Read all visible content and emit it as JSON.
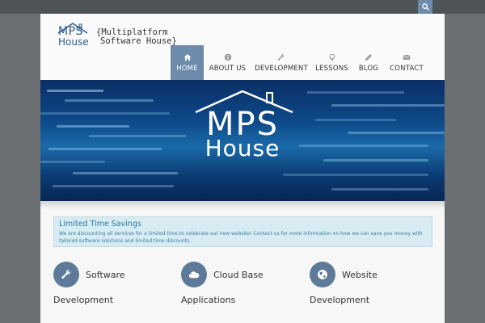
{
  "colors": {
    "accent": "#6d8bab",
    "topbar": "#4e5357",
    "outer": "#6b6f72",
    "notice_bg": "#d7ebf3",
    "notice_text": "#2e7a9c",
    "service_circle": "#5d7b99"
  },
  "topbar": {
    "search_icon": "search-icon"
  },
  "header": {
    "logo_line1": "MPS",
    "logo_line2": "House",
    "tagline_line1": "{Multiplatform",
    "tagline_line2": "Software House}"
  },
  "nav": {
    "items": [
      {
        "label": "HOME",
        "icon": "home-icon",
        "active": true
      },
      {
        "label": "ABOUT US",
        "icon": "info-icon",
        "active": false
      },
      {
        "label": "DEVELOPMENT",
        "icon": "wrench-icon",
        "active": false
      },
      {
        "label": "LESSONS",
        "icon": "lightbulb-icon",
        "active": false
      },
      {
        "label": "BLOG",
        "icon": "pencil-icon",
        "active": false
      },
      {
        "label": "CONTACT",
        "icon": "envelope-icon",
        "active": false
      }
    ]
  },
  "hero": {
    "title": "MPS",
    "subtitle": "House"
  },
  "notice": {
    "title": "Limited Time Savings",
    "text": "We are discounting all services for a limited time to celebrate out new website! Contact us for more information on how we can save you money with tailored software solutions and limited time discounts."
  },
  "services": [
    {
      "title_line1": "Software",
      "title_line2": "Development",
      "icon": "wrench-icon"
    },
    {
      "title_line1": "Cloud Base",
      "title_line2": "Applications",
      "icon": "cloud-icon"
    },
    {
      "title_line1": "Website",
      "title_line2": "Development",
      "icon": "globe-icon"
    }
  ]
}
